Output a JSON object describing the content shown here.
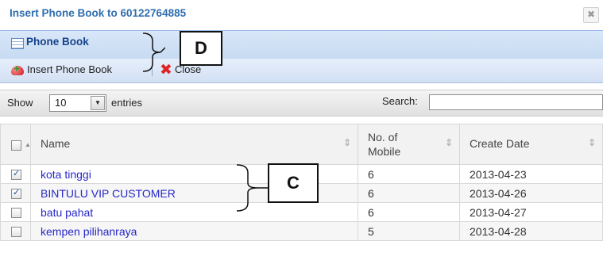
{
  "dialog": {
    "title": "Insert Phone Book to 60122764885",
    "close_glyph": "✖"
  },
  "panel": {
    "title": "Phone Book",
    "icon": "table-icon"
  },
  "toolbar": {
    "insert_label": "Insert Phone Book",
    "insert_icon": "insert-heart-icon",
    "close_label": "Close",
    "close_icon": "red-x-icon"
  },
  "controls": {
    "show_label": "Show",
    "entries_value": "10",
    "entries_label": "entries",
    "search_label": "Search:",
    "search_value": ""
  },
  "table": {
    "columns": [
      "Name",
      "No. of Mobile",
      "Create Date"
    ],
    "rows": [
      {
        "checked": true,
        "name": "kota tinggi",
        "mobile": "6",
        "date": "2013-04-23"
      },
      {
        "checked": true,
        "name": "BINTULU VIP CUSTOMER",
        "mobile": "6",
        "date": "2013-04-26"
      },
      {
        "checked": false,
        "name": "batu pahat",
        "mobile": "6",
        "date": "2013-04-27"
      },
      {
        "checked": false,
        "name": "kempen pilihanraya",
        "mobile": "5",
        "date": "2013-04-28"
      }
    ]
  },
  "annotations": {
    "d_label": "D",
    "c_label": "C"
  },
  "colors": {
    "title_blue": "#2f6eae",
    "link_blue": "#2727c7",
    "header_bg": "#c6daf2"
  }
}
